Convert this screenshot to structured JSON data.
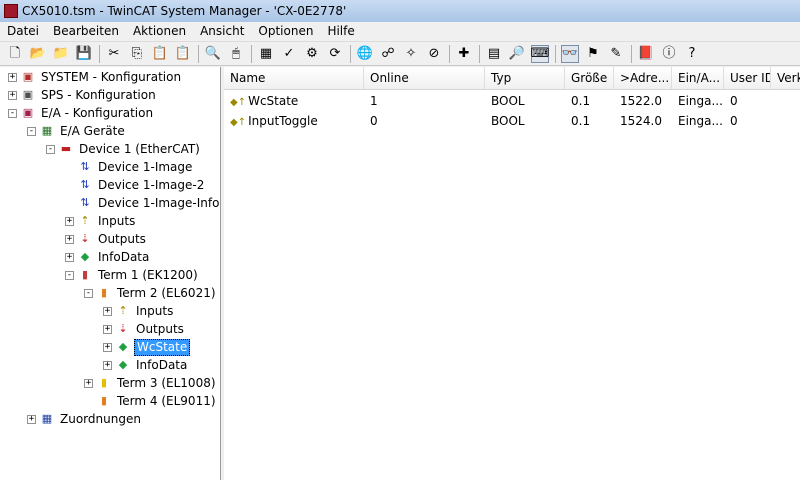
{
  "window": {
    "title": "CX5010.tsm - TwinCAT System Manager - 'CX-0E2778'"
  },
  "menu": [
    "Datei",
    "Bearbeiten",
    "Aktionen",
    "Ansicht",
    "Optionen",
    "Hilfe"
  ],
  "toolbar": {
    "buttons": [
      {
        "name": "new-icon",
        "glyph": "🗋"
      },
      {
        "name": "open-icon",
        "glyph": "📂"
      },
      {
        "name": "open-folder-icon",
        "glyph": "📁"
      },
      {
        "name": "save-icon",
        "glyph": "💾"
      },
      {
        "name": "sep"
      },
      {
        "name": "cut-icon",
        "glyph": "✂"
      },
      {
        "name": "copy-icon",
        "glyph": "⎘"
      },
      {
        "name": "paste-icon",
        "glyph": "📋"
      },
      {
        "name": "paste-with-links-icon",
        "glyph": "📋"
      },
      {
        "name": "sep"
      },
      {
        "name": "find-icon",
        "glyph": "🔍"
      },
      {
        "name": "mouse-icon",
        "glyph": "🖱"
      },
      {
        "name": "sep"
      },
      {
        "name": "generate-mappings-icon",
        "glyph": "▦"
      },
      {
        "name": "check-configuration-icon",
        "glyph": "✓"
      },
      {
        "name": "activate-configuration-icon",
        "glyph": "⚙"
      },
      {
        "name": "restart-icon",
        "glyph": "⟳"
      },
      {
        "name": "sep"
      },
      {
        "name": "choose-target-icon",
        "glyph": "🌐"
      },
      {
        "name": "config-mode-icon",
        "glyph": "☍"
      },
      {
        "name": "magic-wand-icon",
        "glyph": "✧"
      },
      {
        "name": "stop-icon",
        "glyph": "⊘"
      },
      {
        "name": "sep"
      },
      {
        "name": "add-icon",
        "glyph": "✚"
      },
      {
        "name": "sep"
      },
      {
        "name": "show-online-data-icon",
        "glyph": "▤"
      },
      {
        "name": "zoom-icon",
        "glyph": "🔎"
      },
      {
        "name": "online-view-icon",
        "glyph": "⌨",
        "active": true
      },
      {
        "name": "sep"
      },
      {
        "name": "watch-icon",
        "glyph": "👓",
        "active": true
      },
      {
        "name": "force-icon",
        "glyph": "⚑"
      },
      {
        "name": "write-icon",
        "glyph": "✎"
      },
      {
        "name": "sep"
      },
      {
        "name": "book-icon",
        "glyph": "📕"
      },
      {
        "name": "info-icon",
        "glyph": "ⓘ"
      },
      {
        "name": "help-icon",
        "glyph": "?"
      }
    ]
  },
  "tree": [
    {
      "label": "SYSTEM - Konfiguration",
      "indent": 0,
      "exp": "+",
      "icon": "system-icon",
      "glyph": "▣",
      "color": "#b03030"
    },
    {
      "label": "SPS - Konfiguration",
      "indent": 0,
      "exp": "+",
      "icon": "plc-icon",
      "glyph": "▣",
      "color": "#505050"
    },
    {
      "label": "E/A - Konfiguration",
      "indent": 0,
      "exp": "-",
      "icon": "io-config-icon",
      "glyph": "▣",
      "color": "#a02050"
    },
    {
      "label": "E/A Geräte",
      "indent": 1,
      "exp": "-",
      "icon": "io-devices-icon",
      "glyph": "▦",
      "color": "#207020"
    },
    {
      "label": "Device 1 (EtherCAT)",
      "indent": 2,
      "exp": "-",
      "icon": "ethercat-device-icon",
      "glyph": "▬",
      "color": "#c02020"
    },
    {
      "label": "Device 1-Image",
      "indent": 3,
      "exp": "",
      "icon": "image-icon",
      "glyph": "⇅",
      "color": "#2040c0"
    },
    {
      "label": "Device 1-Image-2",
      "indent": 3,
      "exp": "",
      "icon": "image-icon",
      "glyph": "⇅",
      "color": "#2040c0"
    },
    {
      "label": "Device 1-Image-Info",
      "indent": 3,
      "exp": "",
      "icon": "image-icon",
      "glyph": "⇅",
      "color": "#2040c0"
    },
    {
      "label": "Inputs",
      "indent": 3,
      "exp": "+",
      "icon": "inputs-icon",
      "glyph": "⇡",
      "color": "#a08a00"
    },
    {
      "label": "Outputs",
      "indent": 3,
      "exp": "+",
      "icon": "outputs-icon",
      "glyph": "⇣",
      "color": "#c02020"
    },
    {
      "label": "InfoData",
      "indent": 3,
      "exp": "+",
      "icon": "infodata-icon",
      "glyph": "◆",
      "color": "#20a040"
    },
    {
      "label": "Term 1 (EK1200)",
      "indent": 3,
      "exp": "-",
      "icon": "terminal-icon",
      "glyph": "▮",
      "color": "#c04040"
    },
    {
      "label": "Term 2 (EL6021)",
      "indent": 4,
      "exp": "-",
      "icon": "terminal-el6021-icon",
      "glyph": "▮",
      "color": "#e08020"
    },
    {
      "label": "Inputs",
      "indent": 5,
      "exp": "+",
      "icon": "inputs-icon",
      "glyph": "⇡",
      "color": "#a08a00"
    },
    {
      "label": "Outputs",
      "indent": 5,
      "exp": "+",
      "icon": "outputs-icon",
      "glyph": "⇣",
      "color": "#c02020"
    },
    {
      "label": "WcState",
      "indent": 5,
      "exp": "+",
      "icon": "wcstate-icon",
      "glyph": "◆",
      "color": "#20a040",
      "selected": true
    },
    {
      "label": "InfoData",
      "indent": 5,
      "exp": "+",
      "icon": "infodata-icon",
      "glyph": "◆",
      "color": "#20a040"
    },
    {
      "label": "Term 3 (EL1008)",
      "indent": 4,
      "exp": "+",
      "icon": "terminal-el1008-icon",
      "glyph": "▮",
      "color": "#e0c000"
    },
    {
      "label": "Term 4 (EL9011)",
      "indent": 4,
      "exp": "",
      "icon": "terminal-el9011-icon",
      "glyph": "▮",
      "color": "#e08020"
    },
    {
      "label": "Zuordnungen",
      "indent": 1,
      "exp": "+",
      "icon": "mappings-icon",
      "glyph": "▦",
      "color": "#2040a0"
    }
  ],
  "list": {
    "columns": [
      {
        "label": "Name"
      },
      {
        "label": "Online"
      },
      {
        "label": "Typ"
      },
      {
        "label": "Größe"
      },
      {
        "label": ">Adre..."
      },
      {
        "label": "Ein/A..."
      },
      {
        "label": "User ID"
      },
      {
        "label": "Verk"
      }
    ],
    "rows": [
      {
        "cells": [
          "WcState",
          "1",
          "BOOL",
          "0.1",
          "1522.0",
          "Einga...",
          "0",
          ""
        ]
      },
      {
        "cells": [
          "InputToggle",
          "0",
          "BOOL",
          "0.1",
          "1524.0",
          "Einga...",
          "0",
          ""
        ]
      }
    ]
  }
}
